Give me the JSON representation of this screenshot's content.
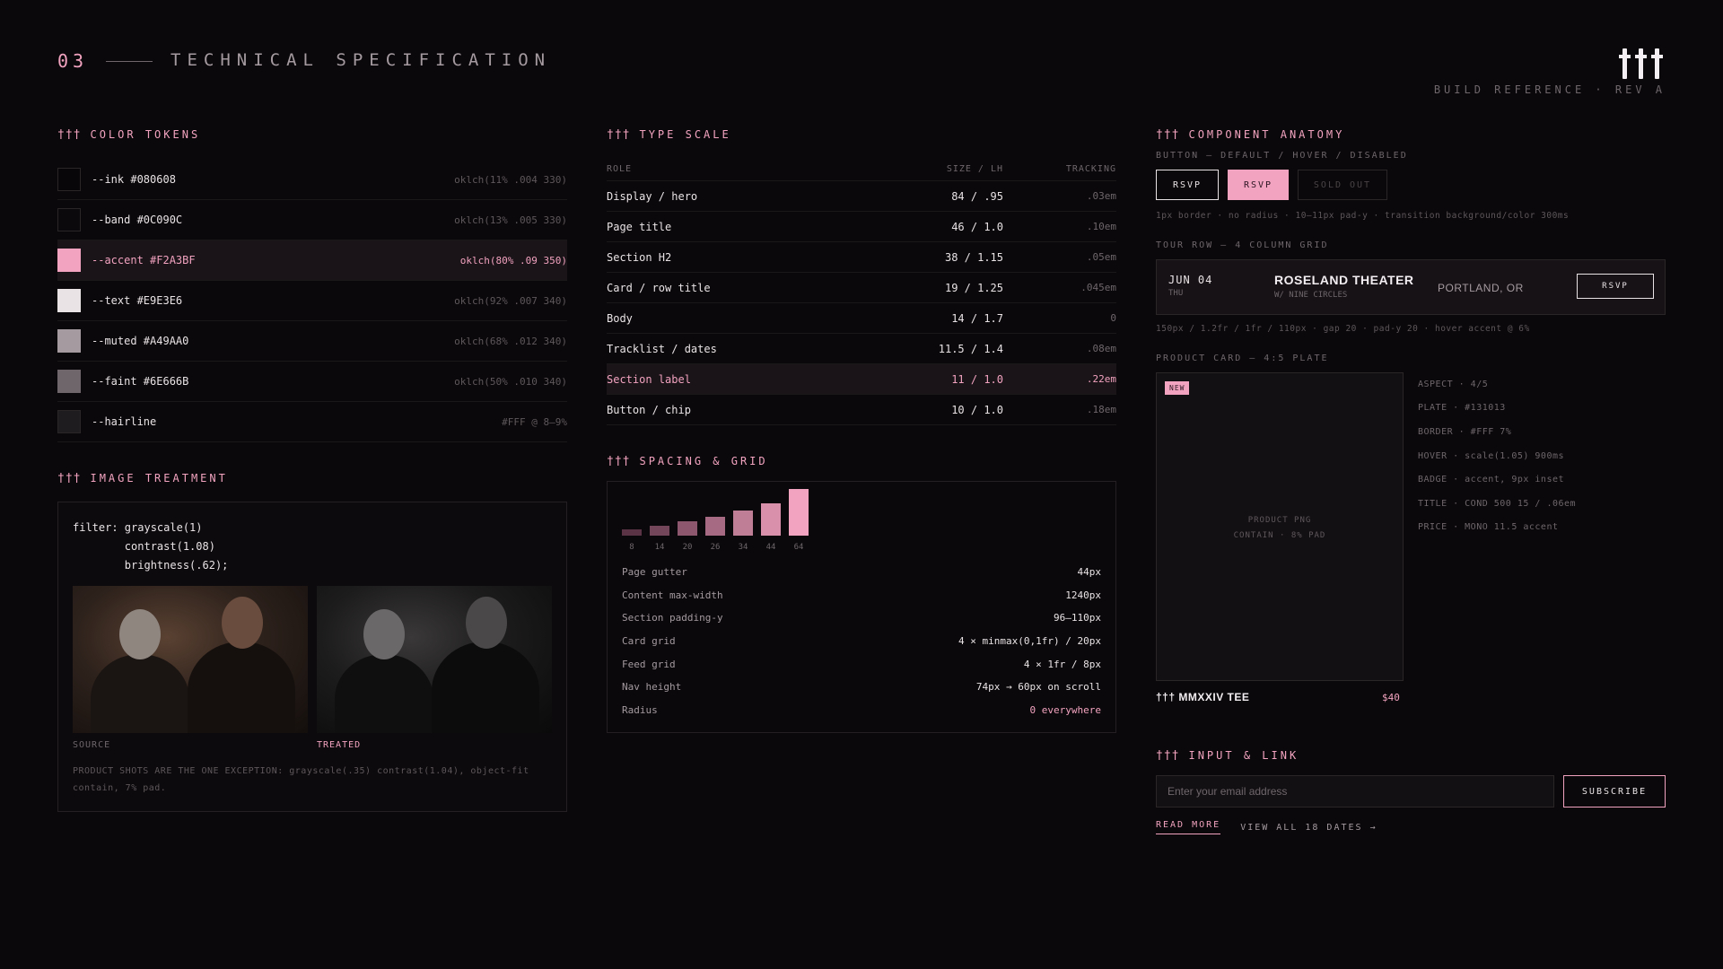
{
  "header": {
    "number": "03",
    "title": "TECHNICAL SPECIFICATION",
    "build_ref": "BUILD REFERENCE · REV A",
    "logo_icon": "triple-dagger-logo"
  },
  "section_glyph": "†††",
  "color_tokens": {
    "title": "COLOR TOKENS",
    "items": [
      {
        "name": "--ink #080608",
        "value": "oklch(11% .004 330)",
        "swatch": "#080608"
      },
      {
        "name": "--band #0C090C",
        "value": "oklch(13% .005 330)",
        "swatch": "#0C090C"
      },
      {
        "name": "--accent #F2A3BF",
        "value": "oklch(80% .09 350)",
        "swatch": "#F2A3BF"
      },
      {
        "name": "--text #E9E3E6",
        "value": "oklch(92% .007 340)",
        "swatch": "#E9E3E6"
      },
      {
        "name": "--muted #A49AA0",
        "value": "oklch(68% .012 340)",
        "swatch": "#A49AA0"
      },
      {
        "name": "--faint #6E666B",
        "value": "oklch(50% .010 340)",
        "swatch": "#6E666B"
      },
      {
        "name": "--hairline",
        "value": "#FFF @ 8–9%",
        "swatch": "#1e1c1e"
      }
    ]
  },
  "image_treatment": {
    "title": "IMAGE TREATMENT",
    "code": "filter: grayscale(1)\n        contrast(1.08)\n        brightness(.62);",
    "source_label": "SOURCE",
    "treated_label": "TREATED",
    "note": "PRODUCT SHOTS ARE THE ONE EXCEPTION: grayscale(.35) contrast(1.04), object-fit contain, 7% pad."
  },
  "type_scale": {
    "title": "TYPE SCALE",
    "headers": {
      "role": "ROLE",
      "size": "SIZE / LH",
      "tracking": "TRACKING"
    },
    "rows": [
      {
        "role": "Display / hero",
        "size": "84 / .95",
        "tracking": ".03em"
      },
      {
        "role": "Page title",
        "size": "46 / 1.0",
        "tracking": ".10em"
      },
      {
        "role": "Section H2",
        "size": "38 / 1.15",
        "tracking": ".05em"
      },
      {
        "role": "Card / row title",
        "size": "19 / 1.25",
        "tracking": ".045em"
      },
      {
        "role": "Body",
        "size": "14 / 1.7",
        "tracking": "0"
      },
      {
        "role": "Tracklist / dates",
        "size": "11.5 / 1.4",
        "tracking": ".08em"
      },
      {
        "role": "Section label",
        "size": "11 / 1.0",
        "tracking": ".22em"
      },
      {
        "role": "Button / chip",
        "size": "10 / 1.0",
        "tracking": ".18em"
      }
    ]
  },
  "spacing": {
    "title": "SPACING & GRID",
    "scale": [
      8,
      14,
      20,
      26,
      34,
      44,
      64
    ],
    "rows": [
      {
        "key": "Page gutter",
        "value": "44px"
      },
      {
        "key": "Content max-width",
        "value": "1240px"
      },
      {
        "key": "Section padding-y",
        "value": "96–110px"
      },
      {
        "key": "Card grid",
        "value": "4 × minmax(0,1fr) / 20px"
      },
      {
        "key": "Feed grid",
        "value": "4 × 1fr / 8px"
      },
      {
        "key": "Nav height",
        "value": "74px → 60px on scroll"
      },
      {
        "key": "Radius",
        "value": "0 everywhere"
      }
    ]
  },
  "component_anatomy": {
    "title": "COMPONENT ANATOMY",
    "button_label": "BUTTON — DEFAULT / HOVER / DISABLED",
    "btn_default": "RSVP",
    "btn_hover": "RSVP",
    "btn_disabled": "SOLD OUT",
    "button_note": "1px border · no radius · 10–11px pad-y · transition background/color 300ms",
    "tour_label": "TOUR ROW — 4 COLUMN GRID",
    "tour": {
      "date": "JUN 04",
      "dow": "THU",
      "venue": "ROSELAND THEATER",
      "with": "W/ NINE CIRCLES",
      "city": "PORTLAND, OR",
      "rsvp": "RSVP"
    },
    "tour_note": "150px / 1.2fr / 1fr / 110px · gap 20 · pad-y 20 · hover accent @ 6%",
    "card_label": "PRODUCT CARD — 4:5 PLATE",
    "card": {
      "badge": "NEW",
      "plate_line1": "PRODUCT PNG",
      "plate_line2": "CONTAIN · 8% PAD",
      "title": "††† MMXXIV TEE",
      "price": "$40"
    },
    "card_specs": [
      "ASPECT · 4/5",
      "PLATE · #131013",
      "BORDER · #FFF 7%",
      "HOVER · scale(1.05) 900ms",
      "BADGE · accent, 9px inset",
      "TITLE · COND 500 15 / .06em",
      "PRICE · MONO 11.5 accent"
    ]
  },
  "input_link": {
    "title": "INPUT & LINK",
    "placeholder": "Enter your email address",
    "subscribe": "SUBSCRIBE",
    "read_more": "READ MORE",
    "view_all": "VIEW ALL 18 DATES →"
  }
}
